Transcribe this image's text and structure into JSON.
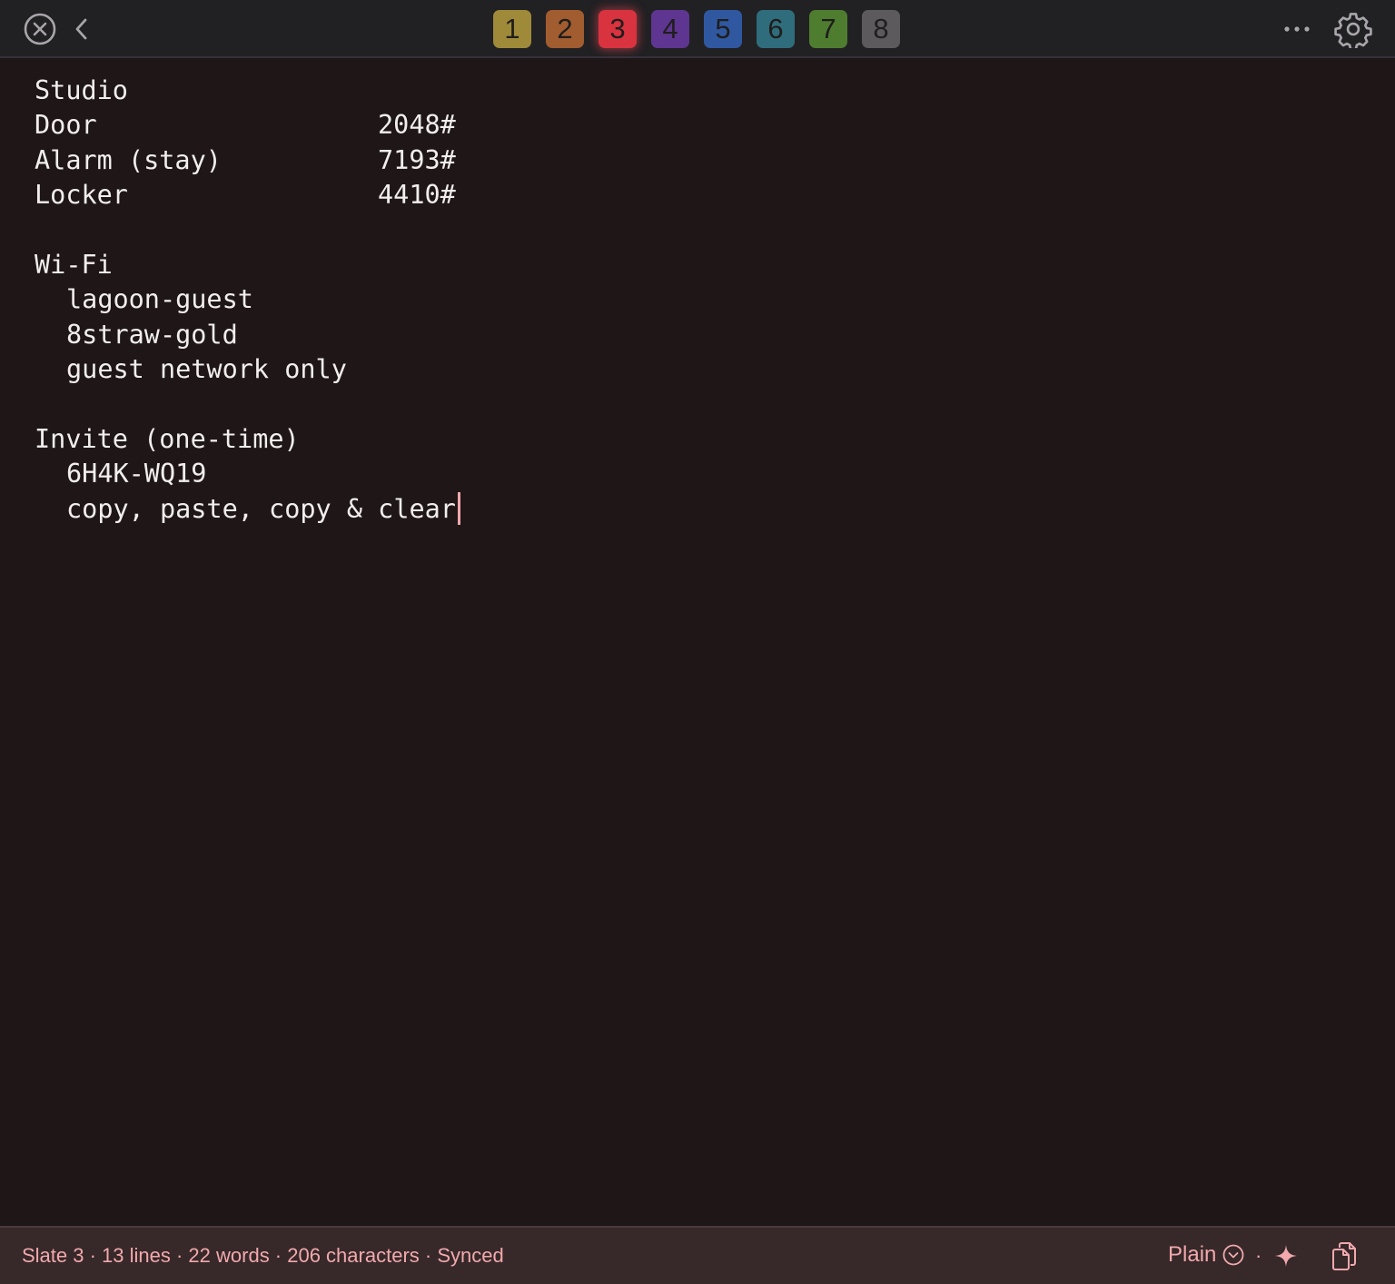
{
  "colors": {
    "background": "#1f1717",
    "titlebar": "#212023",
    "statusbar": "#372829",
    "accent": "#f1a9ad",
    "text": "#f2eeee"
  },
  "titlebar": {
    "tabs": [
      {
        "label": "1",
        "color": "#9f8a3a",
        "active": false
      },
      {
        "label": "2",
        "color": "#a15c2f",
        "active": false
      },
      {
        "label": "3",
        "color": "#d8333f",
        "active": true
      },
      {
        "label": "4",
        "color": "#5e3590",
        "active": false
      },
      {
        "label": "5",
        "color": "#2f58a1",
        "active": false
      },
      {
        "label": "6",
        "color": "#2f6d7c",
        "active": false
      },
      {
        "label": "7",
        "color": "#4e7d2f",
        "active": false
      },
      {
        "label": "8",
        "color": "#5c5a5d",
        "active": false
      }
    ]
  },
  "note": {
    "studio_heading": "Studio",
    "door_label": "Door",
    "door_code": "2048#",
    "alarm_label": "Alarm (stay)",
    "alarm_code": "7193#",
    "locker_label": "Locker",
    "locker_code": "4410#",
    "wifi_heading": "Wi-Fi",
    "wifi_network": "lagoon-guest",
    "wifi_password": "8straw-gold",
    "wifi_note": "guest network only",
    "invite_heading": "Invite (one-time)",
    "invite_code": "6H4K-WQ19",
    "invite_note": "copy, paste, copy & clear"
  },
  "statusbar": {
    "summary": "Slate 3 · 13 lines · 22 words · 206 characters · Synced",
    "mode": "Plain",
    "separator": "·"
  }
}
